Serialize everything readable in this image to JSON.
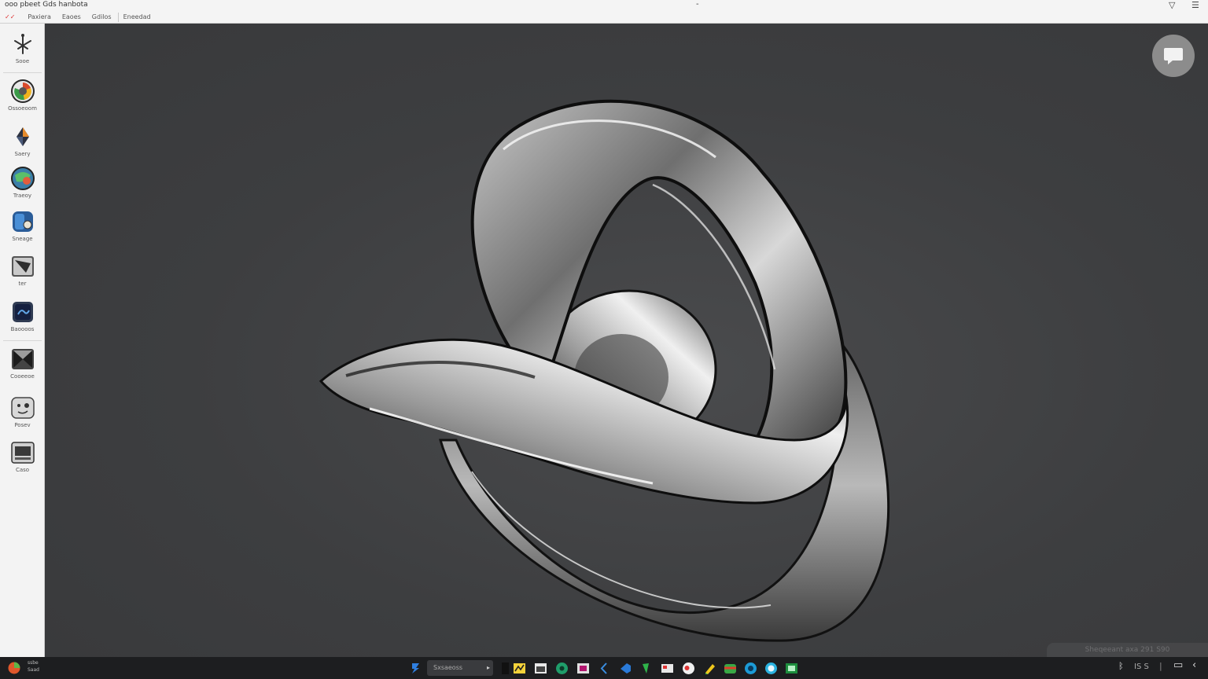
{
  "topbar": {
    "title": "ooo pbeet  Gds  hanbota",
    "center_mark": "-",
    "ctrl_down": "▽",
    "ctrl_menu": "☰",
    "marks": "✓✓",
    "menus": [
      "Paxiera",
      "Eaoes",
      "Gdilos",
      "Eneedad"
    ]
  },
  "dock": {
    "items": [
      {
        "label": "Sooe",
        "icon": "antenna-icon"
      },
      {
        "label": "Ossoeoom",
        "icon": "chrome-like-icon"
      },
      {
        "label": "Saery",
        "icon": "diamond-icon"
      },
      {
        "label": "Traeoy",
        "icon": "globe-icon"
      },
      {
        "label": "Sneage",
        "icon": "blue-app-icon"
      },
      {
        "label": "ter",
        "icon": "folder-icon"
      },
      {
        "label": "Baoooos",
        "icon": "media-icon"
      },
      {
        "label": "Cooeeoe",
        "icon": "window-icon"
      },
      {
        "label": "Posev",
        "icon": "face-icon"
      },
      {
        "label": "Caso",
        "icon": "display-icon"
      }
    ]
  },
  "desktop": {
    "watermark": "Sheqeeant axa 291 S90"
  },
  "taskbar": {
    "user_line1": "ssbe",
    "user_line2": "Saad",
    "search_text": "Sxsaeoss",
    "search_arrow": "▸",
    "apps": [
      "files-icon",
      "notes-icon",
      "terminal-icon",
      "browser-icon",
      "media-icon",
      "back-icon",
      "vscode-icon",
      "leaf-icon",
      "mail-icon",
      "chrome-icon",
      "pen-icon",
      "store-icon",
      "edge-icon",
      "chat-icon",
      "sheet-icon"
    ],
    "tray_bt": "ᛒ",
    "tray_text": "IS S",
    "tray_sep": "|",
    "tray_win": "▭",
    "tray_chev": "‹"
  },
  "colors": {
    "desktop": "#3d3e40",
    "taskbar": "#1d1e20",
    "dock": "#f3f3f3",
    "topbar": "#f4f4f4"
  }
}
